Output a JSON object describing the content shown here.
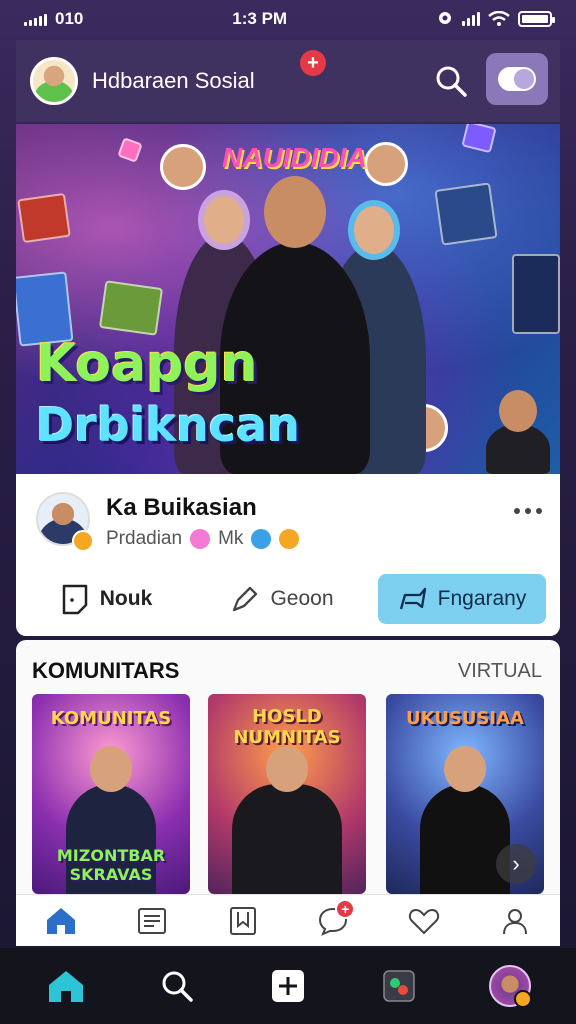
{
  "status_bar": {
    "left_text": "010",
    "time": "1:3 PM"
  },
  "header": {
    "title": "Hdbaraen Sosial",
    "notification_symbol": "+",
    "accent_color": "#e63946"
  },
  "hero": {
    "brand": "NAUIDIDIA",
    "title_line1": "Koapgn",
    "title_line2": "Drbikncan"
  },
  "post": {
    "name": "Ka Buikasian",
    "meta_text1": "Prdadian",
    "meta_text2": "Mk",
    "more_icon": "more-horizontal-icon",
    "actions": {
      "like_label": "Nouk",
      "share_label": "Geoon",
      "send_label": "Fngarany"
    },
    "send_color": "#7dcff0"
  },
  "community": {
    "title": "KOMUNITARS",
    "link_label": "VIRTUAL",
    "cards": [
      {
        "title_top": "KOMUNITAS",
        "title_bottom": "MIZONTBAR SKRAVAS"
      },
      {
        "title_top": "HOSLD NUMNITAS",
        "title_bottom": ""
      },
      {
        "title_top": "UKUSUSIAA",
        "title_bottom": ""
      }
    ],
    "next_symbol": "›"
  },
  "inner_tabs": [
    {
      "icon": "home-icon"
    },
    {
      "icon": "news-icon"
    },
    {
      "icon": "bookmark-icon"
    },
    {
      "icon": "chat-icon",
      "badge": "+"
    },
    {
      "icon": "heart-icon"
    },
    {
      "icon": "profile-icon"
    }
  ],
  "bottom_nav": [
    {
      "icon": "home-icon"
    },
    {
      "icon": "search-icon"
    },
    {
      "icon": "add-icon"
    },
    {
      "icon": "game-icon"
    },
    {
      "icon": "avatar"
    }
  ]
}
